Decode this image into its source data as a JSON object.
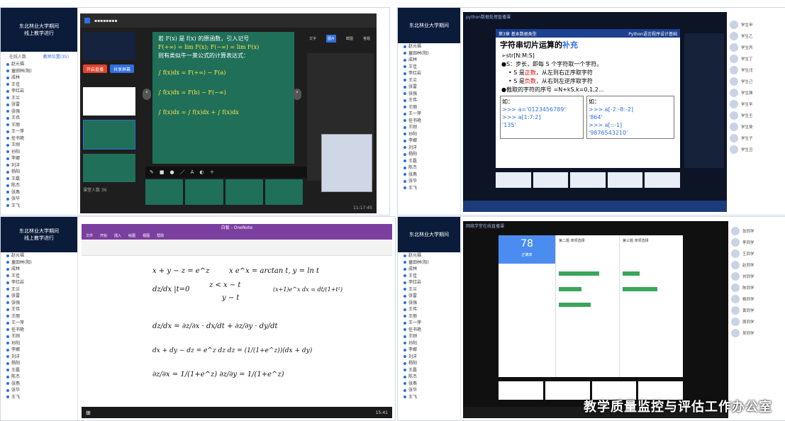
{
  "panels": {
    "tl": {
      "sidebar_title_line1": "东北林业大学期间",
      "sidebar_title_line2": "线上教学进行",
      "tabs": [
        "在线人数",
        "教师位置(35)"
      ],
      "students": [
        "赵元福",
        "童田林(阳)",
        "成林",
        "王佳",
        "李红岩",
        "王兰",
        "张雷",
        "张强",
        "王伟",
        "王丽",
        "王一萍",
        "任书艳",
        "王刚",
        "孙阳",
        "李娜",
        "刘洋",
        "杨阳",
        "王磊",
        "陈杰",
        "张燕",
        "张华",
        "王飞",
        "刘杰",
        "李军",
        "陈林"
      ],
      "tool_tabs": [
        "文字",
        "图片",
        "截图",
        "答题"
      ],
      "slide": {
        "line1": "若 F(x) 是 f(x) 的原函数，引入记号",
        "line2a": "F(+∞) = lim F(x);",
        "line2b": "F(−∞) = lim F(x)",
        "line3": "则有类似牛一莱公式的计算表达式：",
        "eq1": "∫ f(x)dx = F(+∞) − F(a)",
        "eq2": "∫ f(x)dx = F(b) − F(−∞)",
        "eq3": "∫ f(x)dx = ∫ f(x)dx + ∫ f(x)dx"
      },
      "btn_red": "开启直播",
      "btn_blue": "共享屏幕",
      "status": "课堂人数 36",
      "time": "11:17:45"
    },
    "tr": {
      "window_title": "python数据处理直播课",
      "slide_header": "第3章 基本数据类型",
      "slide_course": "Python语言程序设计基础",
      "title_a": "字符串切片运算的",
      "title_b": "补充",
      "line1": "➢str[N:M:S]",
      "line2": "●S：步长，即每 S 个字符取一个字符。",
      "line3a": "• S 是",
      "line3b": "正数",
      "line3c": "，从左到右正序取字符",
      "line4a": "• S 是",
      "line4b": "负数",
      "line4c": "，从右到左逆序取字符",
      "line5": "●截取的字符的序号 =N+kS,k=0,1,2...",
      "code_left_label": "如：",
      "code_left_1": ">>> a='0123456789'",
      "code_left_2": ">>> a[1:7:2]",
      "code_left_3": "'135'",
      "code_right_label": "如：",
      "code_right_1": ">>> a[-2:-8:-2]",
      "code_right_2": "'864'",
      "code_right_3": ">>> a[::-1]",
      "code_right_4": "'9876543210'",
      "chat_names": [
        "学生甲",
        "学生乙",
        "学生丙",
        "学生丁",
        "学生戊",
        "学生己",
        "学生庚",
        "学生辛",
        "学生壬",
        "学生癸",
        "学生子",
        "学生丑"
      ]
    },
    "bl": {
      "app_title": "白板 - OneNote",
      "menu": [
        "文件",
        "开始",
        "插入",
        "绘图",
        "视图",
        "帮助"
      ],
      "eq1": "x + y − z = e^z",
      "eq2": "x e^x = arctan t,  y = ln t",
      "eq3": "dz/dx |t=0",
      "eq4": "z < x − t",
      "eq5": "y − t",
      "eq6": "(x+1)e^x dx = dt/(1+t²)",
      "eq7": "dz/dx = ∂z/∂x · dx/dt + ∂z/∂y · dy/dt",
      "eq8": "dx + dy − dz = e^z dz     dz = (1/(1+e^z))(dx + dy)",
      "eq9": "∂z/∂x = 1/(1+e^z)     ∂z/∂y = 1/(1+e^z)",
      "taskbar_time": "15:41"
    },
    "br": {
      "window_title": "网络学堂在线直播课",
      "score": "78",
      "score_label": "正确率",
      "q_title_1": "第二题 单项选择",
      "q_title_2": "第三题 单项选择",
      "chat_names": [
        "张同学",
        "李同学",
        "王同学",
        "赵同学",
        "刘同学",
        "陈同学",
        "杨同学",
        "黄同学",
        "周同学",
        "吴同学"
      ]
    }
  },
  "watermark": "教学质量监控与评估工作办公室",
  "colors": {
    "green_board": "#1f6f59",
    "dark_ui": "#1e1e1e",
    "blue": "#2f6fe0",
    "red": "#e0452f"
  }
}
